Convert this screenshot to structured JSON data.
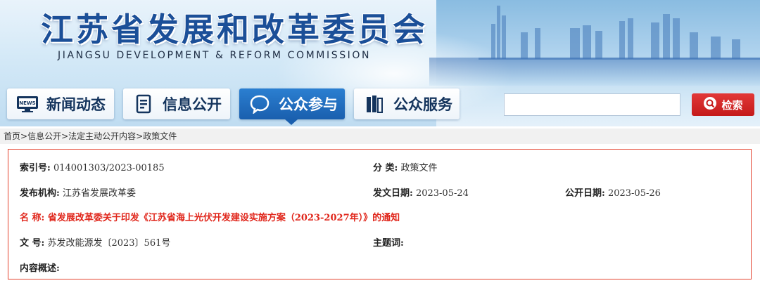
{
  "header": {
    "title_cn": "江苏省发展和改革委员会",
    "title_en": "JIANGSU DEVELOPMENT & REFORM COMMISSION"
  },
  "nav": [
    {
      "label": "新闻动态",
      "icon": "news-icon",
      "active": false
    },
    {
      "label": "信息公开",
      "icon": "document-icon",
      "active": false
    },
    {
      "label": "公众参与",
      "icon": "chat-bubble-icon",
      "active": true
    },
    {
      "label": "公众服务",
      "icon": "book-icon",
      "active": false
    }
  ],
  "search": {
    "placeholder": "",
    "button_label": "检索",
    "icon": "search-icon"
  },
  "breadcrumb": {
    "items": [
      "首页",
      "信息公开",
      "法定主动公开内容",
      "政策文件"
    ],
    "separator": ">"
  },
  "info": {
    "index_label": "索引号:",
    "index_value": "014001303/2023-00185",
    "category_label": "分 类:",
    "category_value": "政策文件",
    "org_label": "发布机构:",
    "org_value": "江苏省发展改革委",
    "issue_date_label": "发文日期:",
    "issue_date_value": "2023-05-24",
    "public_date_label": "公开日期:",
    "public_date_value": "2023-05-26",
    "name_label": "名 称:",
    "name_value": "省发展改革委关于印发《江苏省海上光伏开发建设实施方案（2023-2027年）》的通知",
    "doc_no_label": "文 号:",
    "doc_no_value": "苏发改能源发〔2023〕561号",
    "keywords_label": "主题词:",
    "keywords_value": "",
    "summary_label": "内容概述:",
    "summary_value": ""
  },
  "colors": {
    "brand_blue": "#1b4f98",
    "active_nav": "#1a5fae",
    "accent_red": "#e0261b",
    "search_red": "#c41a1a"
  }
}
